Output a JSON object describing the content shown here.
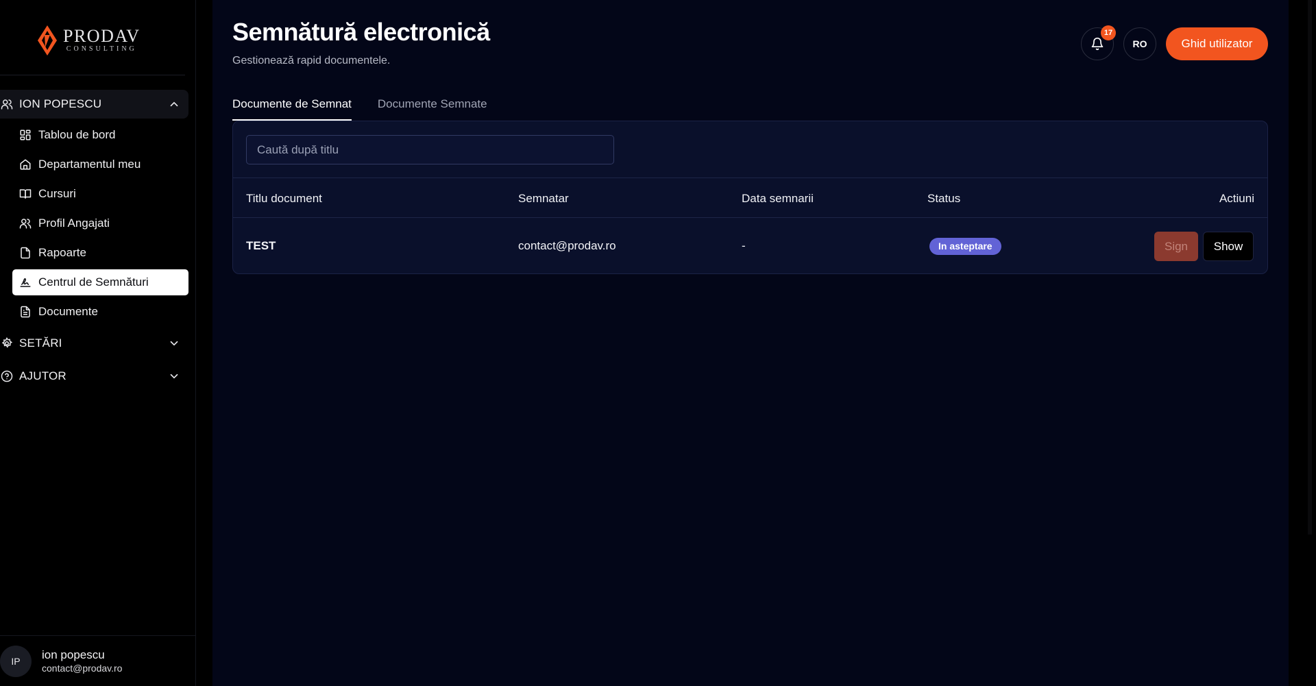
{
  "sidebar": {
    "logo": {
      "name": "PRODAV",
      "sub": "CONSULTING"
    },
    "groups": {
      "user": {
        "label": "ION POPESCU"
      },
      "settings": {
        "label": "SETĂRI"
      },
      "help": {
        "label": "AJUTOR"
      }
    },
    "items": [
      {
        "label": "Tablou de bord",
        "icon": "dashboard-icon"
      },
      {
        "label": "Departamentul meu",
        "icon": "home-icon"
      },
      {
        "label": "Cursuri",
        "icon": "book-icon"
      },
      {
        "label": "Profil Angajati",
        "icon": "users-icon"
      },
      {
        "label": "Rapoarte",
        "icon": "file-icon"
      },
      {
        "label": "Centrul de Semnături",
        "icon": "signature-icon",
        "active": true
      },
      {
        "label": "Documente",
        "icon": "document-icon"
      }
    ],
    "footer": {
      "initials": "IP",
      "name": "ion popescu",
      "email": "contact@prodav.ro"
    }
  },
  "header": {
    "title": "Semnătură electronică",
    "subtitle": "Gestionează rapid documentele.",
    "notifications_count": "17",
    "language": "RO",
    "guide_label": "Ghid utilizator"
  },
  "tabs": [
    {
      "label": "Documente de Semnat",
      "active": true
    },
    {
      "label": "Documente Semnate",
      "active": false
    }
  ],
  "search": {
    "placeholder": "Caută după titlu",
    "value": ""
  },
  "table": {
    "columns": [
      "Titlu document",
      "Semnatar",
      "Data semnarii",
      "Status",
      "Actiuni"
    ],
    "rows": [
      {
        "title": "TEST",
        "signer": "contact@prodav.ro",
        "date": "-",
        "status": "In asteptare",
        "sign_label": "Sign",
        "show_label": "Show"
      }
    ]
  },
  "colors": {
    "accent": "#f2551f",
    "status_pending": "#6263d6",
    "sign_button": "#8b3a2f",
    "main_bg": "#030618",
    "card_bg": "#0a102b"
  }
}
